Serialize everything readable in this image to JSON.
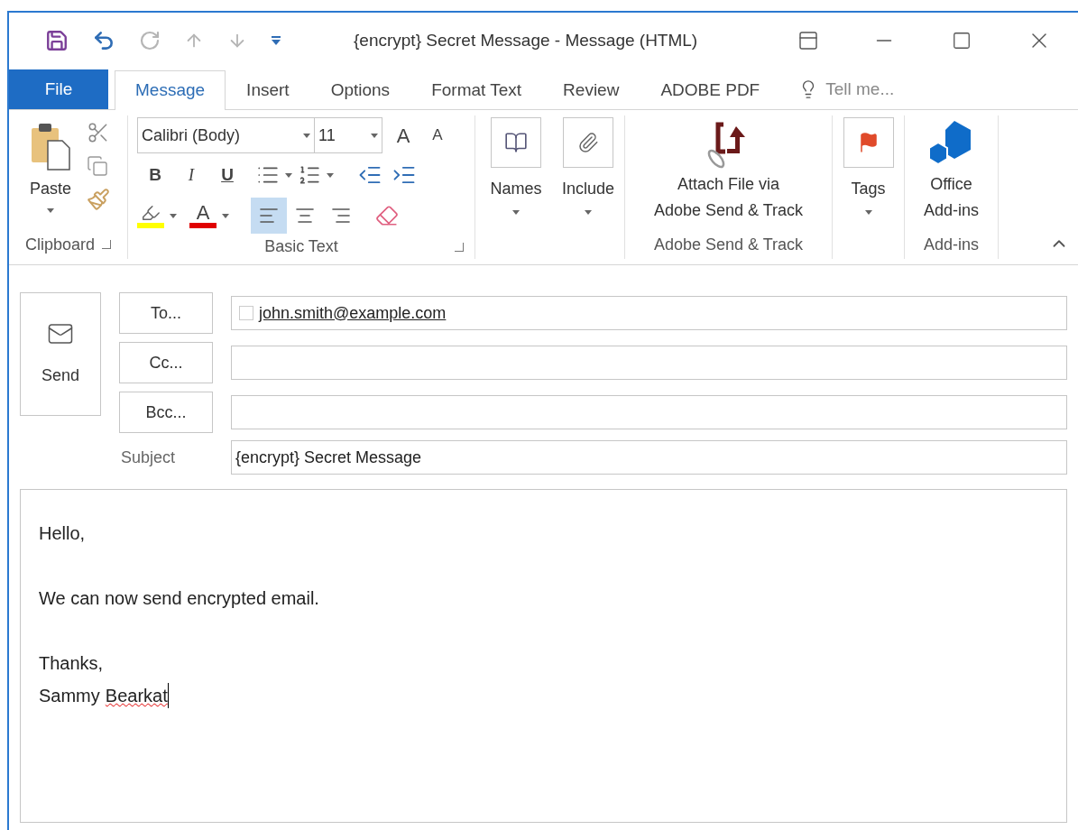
{
  "window": {
    "title": "{encrypt} Secret Message - Message (HTML)"
  },
  "quick_access": [
    {
      "kind": "save",
      "disabled": false
    },
    {
      "kind": "undo",
      "disabled": false
    },
    {
      "kind": "redo",
      "disabled": true
    },
    {
      "kind": "up",
      "disabled": true
    },
    {
      "kind": "down",
      "disabled": true
    },
    {
      "kind": "customize",
      "disabled": false
    }
  ],
  "tabs": [
    {
      "label": "File",
      "kind": "file",
      "selected": false
    },
    {
      "label": "Message",
      "kind": "tab",
      "selected": true
    },
    {
      "label": "Insert",
      "kind": "tab",
      "selected": false
    },
    {
      "label": "Options",
      "kind": "tab",
      "selected": false
    },
    {
      "label": "Format Text",
      "kind": "tab",
      "selected": false
    },
    {
      "label": "Review",
      "kind": "tab",
      "selected": false
    },
    {
      "label": "ADOBE PDF",
      "kind": "tab",
      "selected": false
    }
  ],
  "tell_me": {
    "placeholder": "Tell me..."
  },
  "ribbon": {
    "clipboard": {
      "paste": "Paste",
      "label": "Clipboard"
    },
    "basic_text": {
      "font": "Calibri (Body)",
      "size": "11",
      "grow_font": "A",
      "shrink_font": "A",
      "bold": "B",
      "italic": "I",
      "underline": "U",
      "font_color": "A",
      "alignment": [
        {
          "kind": "left",
          "selected": true
        },
        {
          "kind": "center",
          "selected": false
        },
        {
          "kind": "right",
          "selected": false
        }
      ],
      "label": "Basic Text"
    },
    "names": {
      "names": "Names",
      "include": "Include"
    },
    "adobe": {
      "button": [
        "Attach File via",
        "Adobe Send & Track"
      ],
      "label": "Adobe Send & Track"
    },
    "tags": {
      "tags": "Tags"
    },
    "addins": {
      "button": [
        "Office",
        "Add-ins"
      ],
      "label": "Add-ins"
    }
  },
  "compose": {
    "send": "Send",
    "recipients": [
      {
        "button": "To...",
        "value": "john.smith@example.com"
      },
      {
        "button": "Cc..."
      },
      {
        "button": "Bcc..."
      }
    ],
    "subject": {
      "label": "Subject",
      "value": "{encrypt} Secret Message"
    },
    "body": [
      [
        [
          {
            "text": "Hello,",
            "misspelled": false
          }
        ]
      ],
      [
        [
          {
            "text": "We can now send encrypted email.",
            "misspelled": false
          }
        ]
      ],
      [
        [
          {
            "text": "Thanks,",
            "misspelled": false
          }
        ],
        [
          {
            "text": "Sammy",
            "misspelled": false
          },
          {
            "text": "Bearkat",
            "misspelled": true
          }
        ]
      ]
    ]
  }
}
